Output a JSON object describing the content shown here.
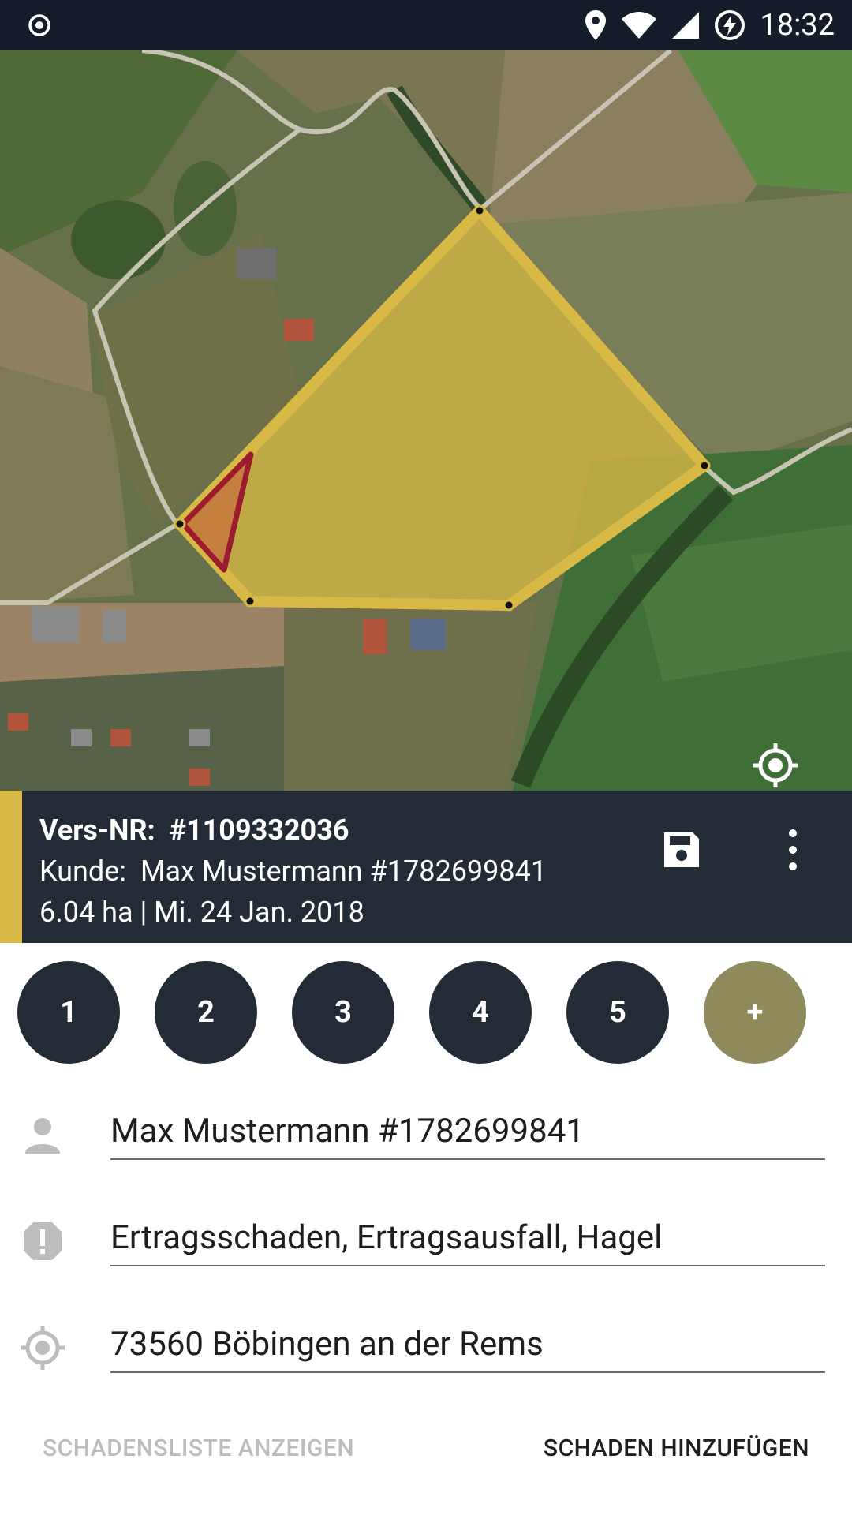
{
  "status_bar": {
    "time": "18:32",
    "icons": [
      "target-icon",
      "location-pin-icon",
      "wifi-icon",
      "signal-icon",
      "battery-charging-icon"
    ]
  },
  "map": {
    "field_color": "#d8b945",
    "damage_color": "#9b1c2e",
    "locate_icon": "my-location-icon"
  },
  "info": {
    "vers_label": "Vers-NR:",
    "vers_value": "#1109332036",
    "kunde_label": "Kunde:",
    "kunde_value": "Max Mustermann #1782699841",
    "meta": "6.04 ha | Mi. 24 Jan. 2018",
    "save_icon": "save-icon",
    "more_icon": "more-vert-icon"
  },
  "damage_tabs": [
    "1",
    "2",
    "3",
    "4",
    "5"
  ],
  "add_tab_label": "+",
  "form": {
    "customer": "Max Mustermann #1782699841",
    "damage_type": "Ertragsschaden, Ertragsausfall, Hagel",
    "location": "73560 Böbingen an der Rems"
  },
  "actions": {
    "show_list": "SCHADENSLISTE ANZEIGEN",
    "add_damage": "SCHADEN HINZUFÜGEN"
  },
  "colors": {
    "dark": "#232b37",
    "status": "#131c28",
    "accent": "#d8b945",
    "add_button": "#8f8a5c"
  }
}
